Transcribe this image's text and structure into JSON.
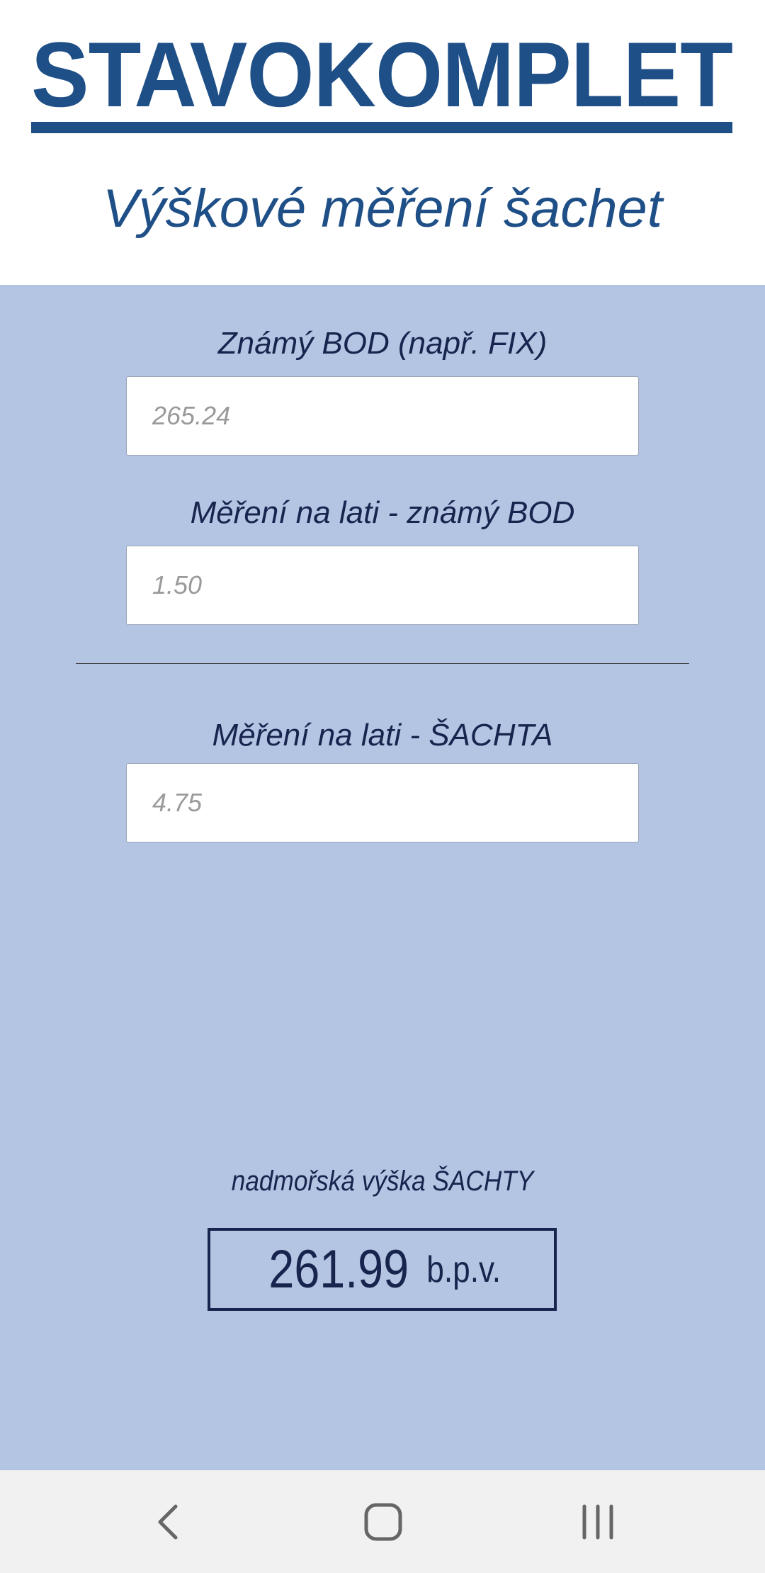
{
  "header": {
    "logo_text": "STAVOKOMPLET",
    "subtitle": "Výškové měření šachet"
  },
  "form": {
    "known_point": {
      "label": "Známý BOD (např. FIX)",
      "placeholder": "265.24",
      "value": ""
    },
    "staff_reading_known": {
      "label": "Měření na lati - známý BOD",
      "placeholder": "1.50",
      "value": ""
    },
    "staff_reading_shaft": {
      "label": "Měření na lati - ŠACHTA",
      "placeholder": "4.75",
      "value": ""
    }
  },
  "result": {
    "label": "nadmořská výška ŠACHTY",
    "value": "261.99",
    "unit": "b.p.v."
  },
  "navbar": {
    "back_icon": "chevron-left-icon",
    "home_icon": "home-icon",
    "recents_icon": "recents-icon"
  },
  "colors": {
    "brand": "#1f4f87",
    "panel_background": "#b3c5e3",
    "text_dark": "#17244d",
    "navbar_background": "#f1f1f1"
  }
}
